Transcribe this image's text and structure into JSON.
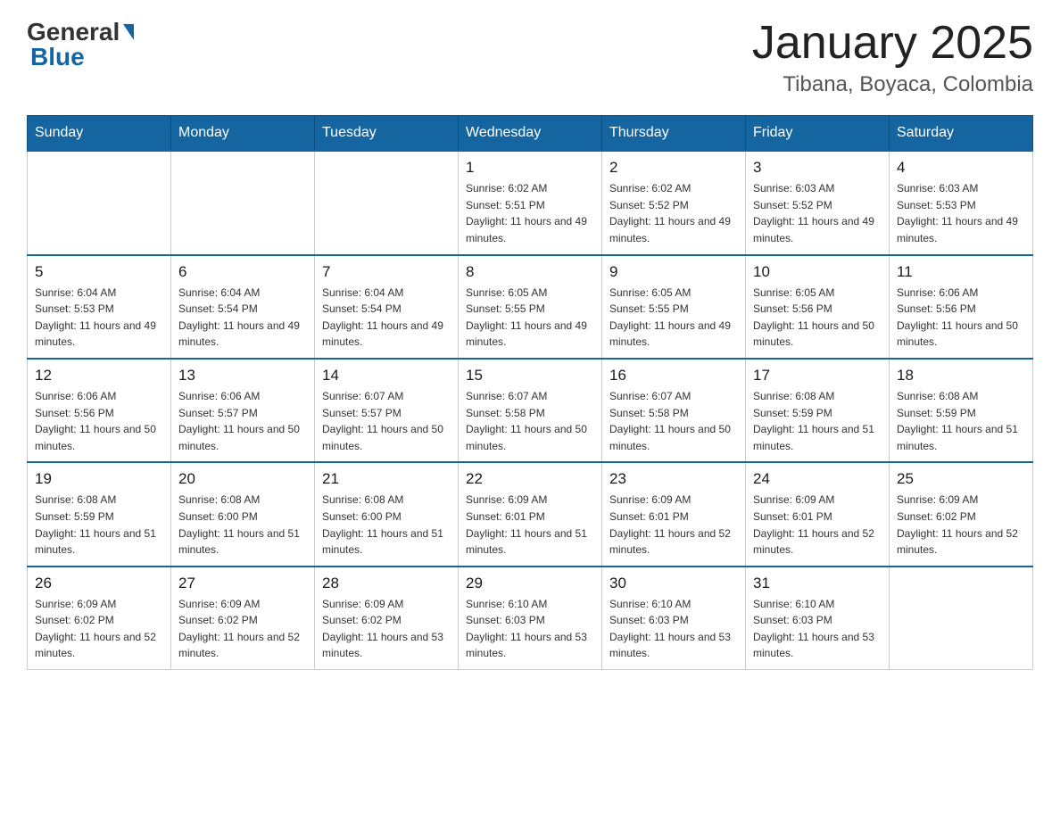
{
  "header": {
    "logo_general": "General",
    "logo_blue": "Blue",
    "month_title": "January 2025",
    "location": "Tibana, Boyaca, Colombia"
  },
  "weekdays": [
    "Sunday",
    "Monday",
    "Tuesday",
    "Wednesday",
    "Thursday",
    "Friday",
    "Saturday"
  ],
  "weeks": [
    [
      {
        "day": "",
        "sunrise": "",
        "sunset": "",
        "daylight": ""
      },
      {
        "day": "",
        "sunrise": "",
        "sunset": "",
        "daylight": ""
      },
      {
        "day": "",
        "sunrise": "",
        "sunset": "",
        "daylight": ""
      },
      {
        "day": "1",
        "sunrise": "Sunrise: 6:02 AM",
        "sunset": "Sunset: 5:51 PM",
        "daylight": "Daylight: 11 hours and 49 minutes."
      },
      {
        "day": "2",
        "sunrise": "Sunrise: 6:02 AM",
        "sunset": "Sunset: 5:52 PM",
        "daylight": "Daylight: 11 hours and 49 minutes."
      },
      {
        "day": "3",
        "sunrise": "Sunrise: 6:03 AM",
        "sunset": "Sunset: 5:52 PM",
        "daylight": "Daylight: 11 hours and 49 minutes."
      },
      {
        "day": "4",
        "sunrise": "Sunrise: 6:03 AM",
        "sunset": "Sunset: 5:53 PM",
        "daylight": "Daylight: 11 hours and 49 minutes."
      }
    ],
    [
      {
        "day": "5",
        "sunrise": "Sunrise: 6:04 AM",
        "sunset": "Sunset: 5:53 PM",
        "daylight": "Daylight: 11 hours and 49 minutes."
      },
      {
        "day": "6",
        "sunrise": "Sunrise: 6:04 AM",
        "sunset": "Sunset: 5:54 PM",
        "daylight": "Daylight: 11 hours and 49 minutes."
      },
      {
        "day": "7",
        "sunrise": "Sunrise: 6:04 AM",
        "sunset": "Sunset: 5:54 PM",
        "daylight": "Daylight: 11 hours and 49 minutes."
      },
      {
        "day": "8",
        "sunrise": "Sunrise: 6:05 AM",
        "sunset": "Sunset: 5:55 PM",
        "daylight": "Daylight: 11 hours and 49 minutes."
      },
      {
        "day": "9",
        "sunrise": "Sunrise: 6:05 AM",
        "sunset": "Sunset: 5:55 PM",
        "daylight": "Daylight: 11 hours and 49 minutes."
      },
      {
        "day": "10",
        "sunrise": "Sunrise: 6:05 AM",
        "sunset": "Sunset: 5:56 PM",
        "daylight": "Daylight: 11 hours and 50 minutes."
      },
      {
        "day": "11",
        "sunrise": "Sunrise: 6:06 AM",
        "sunset": "Sunset: 5:56 PM",
        "daylight": "Daylight: 11 hours and 50 minutes."
      }
    ],
    [
      {
        "day": "12",
        "sunrise": "Sunrise: 6:06 AM",
        "sunset": "Sunset: 5:56 PM",
        "daylight": "Daylight: 11 hours and 50 minutes."
      },
      {
        "day": "13",
        "sunrise": "Sunrise: 6:06 AM",
        "sunset": "Sunset: 5:57 PM",
        "daylight": "Daylight: 11 hours and 50 minutes."
      },
      {
        "day": "14",
        "sunrise": "Sunrise: 6:07 AM",
        "sunset": "Sunset: 5:57 PM",
        "daylight": "Daylight: 11 hours and 50 minutes."
      },
      {
        "day": "15",
        "sunrise": "Sunrise: 6:07 AM",
        "sunset": "Sunset: 5:58 PM",
        "daylight": "Daylight: 11 hours and 50 minutes."
      },
      {
        "day": "16",
        "sunrise": "Sunrise: 6:07 AM",
        "sunset": "Sunset: 5:58 PM",
        "daylight": "Daylight: 11 hours and 50 minutes."
      },
      {
        "day": "17",
        "sunrise": "Sunrise: 6:08 AM",
        "sunset": "Sunset: 5:59 PM",
        "daylight": "Daylight: 11 hours and 51 minutes."
      },
      {
        "day": "18",
        "sunrise": "Sunrise: 6:08 AM",
        "sunset": "Sunset: 5:59 PM",
        "daylight": "Daylight: 11 hours and 51 minutes."
      }
    ],
    [
      {
        "day": "19",
        "sunrise": "Sunrise: 6:08 AM",
        "sunset": "Sunset: 5:59 PM",
        "daylight": "Daylight: 11 hours and 51 minutes."
      },
      {
        "day": "20",
        "sunrise": "Sunrise: 6:08 AM",
        "sunset": "Sunset: 6:00 PM",
        "daylight": "Daylight: 11 hours and 51 minutes."
      },
      {
        "day": "21",
        "sunrise": "Sunrise: 6:08 AM",
        "sunset": "Sunset: 6:00 PM",
        "daylight": "Daylight: 11 hours and 51 minutes."
      },
      {
        "day": "22",
        "sunrise": "Sunrise: 6:09 AM",
        "sunset": "Sunset: 6:01 PM",
        "daylight": "Daylight: 11 hours and 51 minutes."
      },
      {
        "day": "23",
        "sunrise": "Sunrise: 6:09 AM",
        "sunset": "Sunset: 6:01 PM",
        "daylight": "Daylight: 11 hours and 52 minutes."
      },
      {
        "day": "24",
        "sunrise": "Sunrise: 6:09 AM",
        "sunset": "Sunset: 6:01 PM",
        "daylight": "Daylight: 11 hours and 52 minutes."
      },
      {
        "day": "25",
        "sunrise": "Sunrise: 6:09 AM",
        "sunset": "Sunset: 6:02 PM",
        "daylight": "Daylight: 11 hours and 52 minutes."
      }
    ],
    [
      {
        "day": "26",
        "sunrise": "Sunrise: 6:09 AM",
        "sunset": "Sunset: 6:02 PM",
        "daylight": "Daylight: 11 hours and 52 minutes."
      },
      {
        "day": "27",
        "sunrise": "Sunrise: 6:09 AM",
        "sunset": "Sunset: 6:02 PM",
        "daylight": "Daylight: 11 hours and 52 minutes."
      },
      {
        "day": "28",
        "sunrise": "Sunrise: 6:09 AM",
        "sunset": "Sunset: 6:02 PM",
        "daylight": "Daylight: 11 hours and 53 minutes."
      },
      {
        "day": "29",
        "sunrise": "Sunrise: 6:10 AM",
        "sunset": "Sunset: 6:03 PM",
        "daylight": "Daylight: 11 hours and 53 minutes."
      },
      {
        "day": "30",
        "sunrise": "Sunrise: 6:10 AM",
        "sunset": "Sunset: 6:03 PM",
        "daylight": "Daylight: 11 hours and 53 minutes."
      },
      {
        "day": "31",
        "sunrise": "Sunrise: 6:10 AM",
        "sunset": "Sunset: 6:03 PM",
        "daylight": "Daylight: 11 hours and 53 minutes."
      },
      {
        "day": "",
        "sunrise": "",
        "sunset": "",
        "daylight": ""
      }
    ]
  ]
}
